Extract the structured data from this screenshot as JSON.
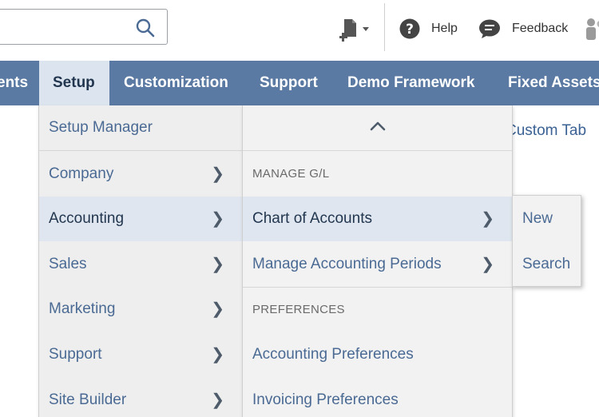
{
  "header": {
    "search": {
      "value": "",
      "placeholder": ""
    },
    "help_label": "Help",
    "feedback_label": "Feedback"
  },
  "navbar": {
    "items": [
      {
        "label": "ents"
      },
      {
        "label": "Setup",
        "active": true
      },
      {
        "label": "Customization"
      },
      {
        "label": "Support"
      },
      {
        "label": "Demo Framework"
      },
      {
        "label": "Fixed Assets"
      }
    ]
  },
  "page": {
    "custom_tab_link": "Custom Tab"
  },
  "setup_menu": {
    "items": [
      {
        "label": "Setup Manager",
        "has_submenu": false
      },
      {
        "label": "Company",
        "has_submenu": true
      },
      {
        "label": "Accounting",
        "has_submenu": true,
        "highlighted": true
      },
      {
        "label": "Sales",
        "has_submenu": true
      },
      {
        "label": "Marketing",
        "has_submenu": true
      },
      {
        "label": "Support",
        "has_submenu": true
      },
      {
        "label": "Site Builder",
        "has_submenu": true
      }
    ]
  },
  "accounting_menu": {
    "scroll_up_icon": "chevron-up-icon",
    "section_manage_gl": "MANAGE G/L",
    "section_preferences": "PREFERENCES",
    "items": [
      {
        "label": "Chart of Accounts",
        "has_submenu": true,
        "highlighted": true
      },
      {
        "label": "Manage Accounting Periods",
        "has_submenu": true
      },
      {
        "label": "Accounting Preferences",
        "has_submenu": false
      },
      {
        "label": "Invoicing Preferences",
        "has_submenu": false
      }
    ]
  },
  "chart_of_accounts_menu": {
    "items": [
      {
        "label": "New"
      },
      {
        "label": "Search"
      }
    ]
  },
  "colors": {
    "navbar_bg": "#5b7aa3",
    "nav_active_bg": "#dce5ef",
    "menu_bg": "#eeeeee",
    "highlight_bg": "#dfe6ef",
    "link_text": "#4a6a94"
  }
}
